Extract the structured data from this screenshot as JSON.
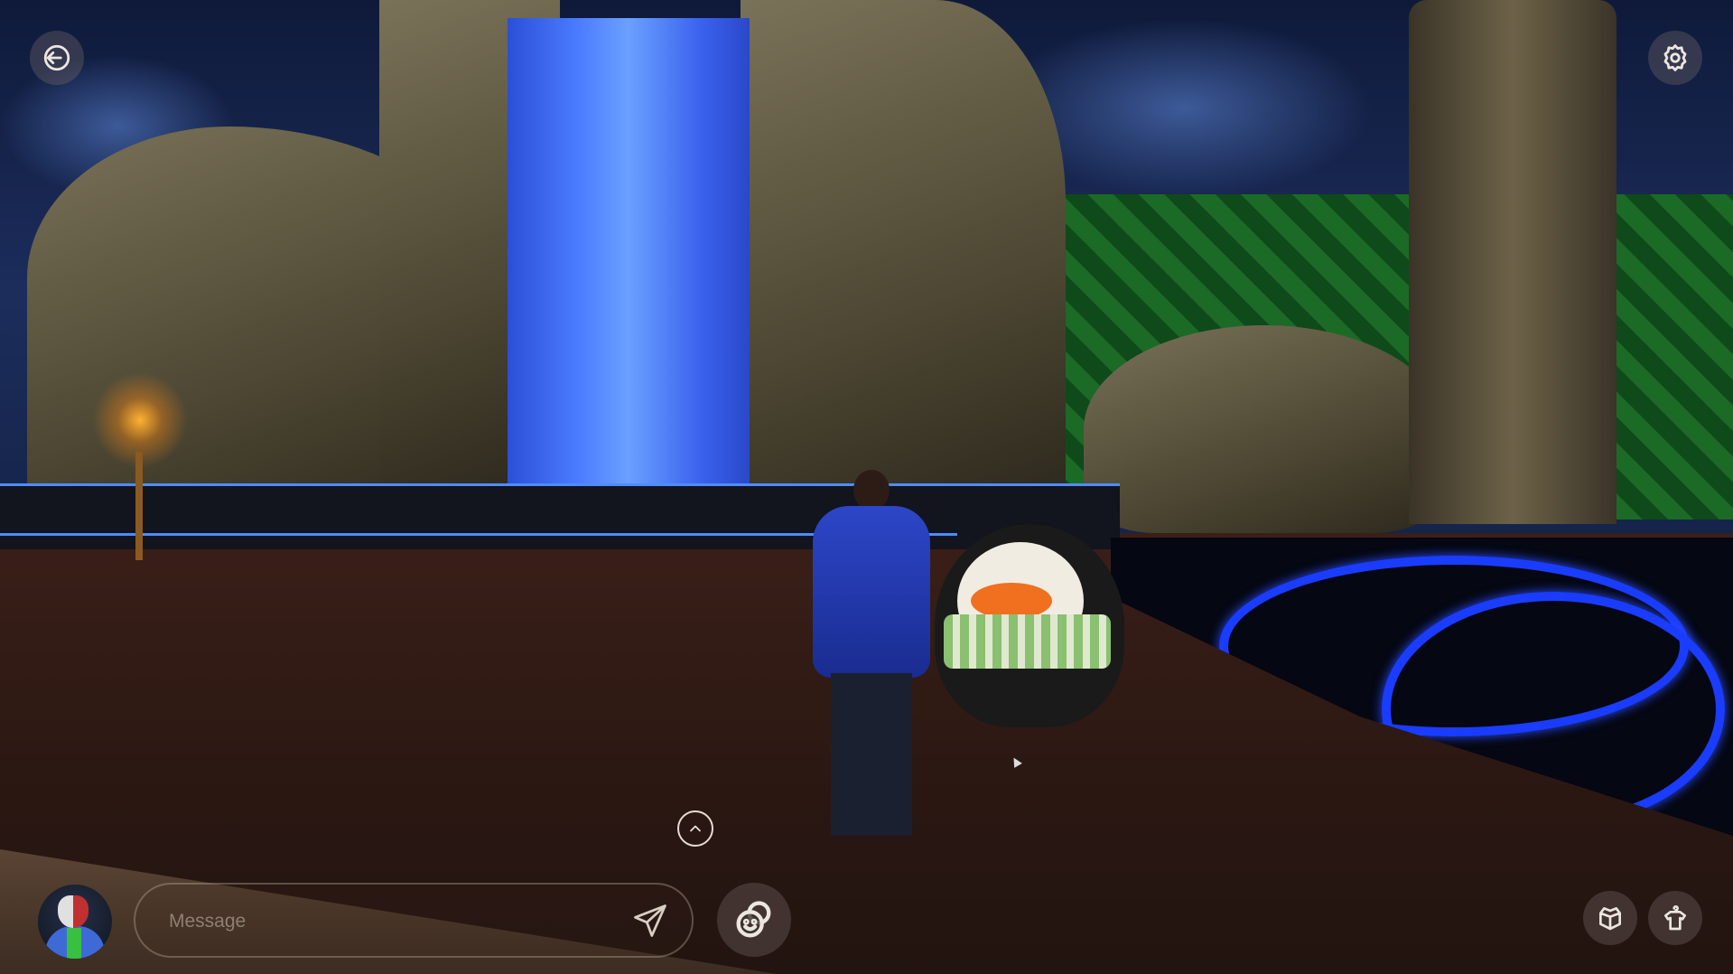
{
  "hud": {
    "exit_icon": "exit-door-arrow-icon",
    "settings_icon": "gear-icon",
    "expand_icon": "chevron-up-icon",
    "emote_icon": "emoji-bubbles-icon",
    "inventory_icon": "open-box-icon",
    "wardrobe_icon": "shirt-hanger-icon",
    "send_icon": "paper-plane-icon"
  },
  "chat": {
    "message_placeholder": "Message",
    "message_value": ""
  },
  "colors": {
    "ui_stroke": "#ece6e0",
    "button_bg": "rgba(120,110,105,0.35)",
    "waterfall": "#4c7dff",
    "neon_floor": "#1a3cff"
  }
}
